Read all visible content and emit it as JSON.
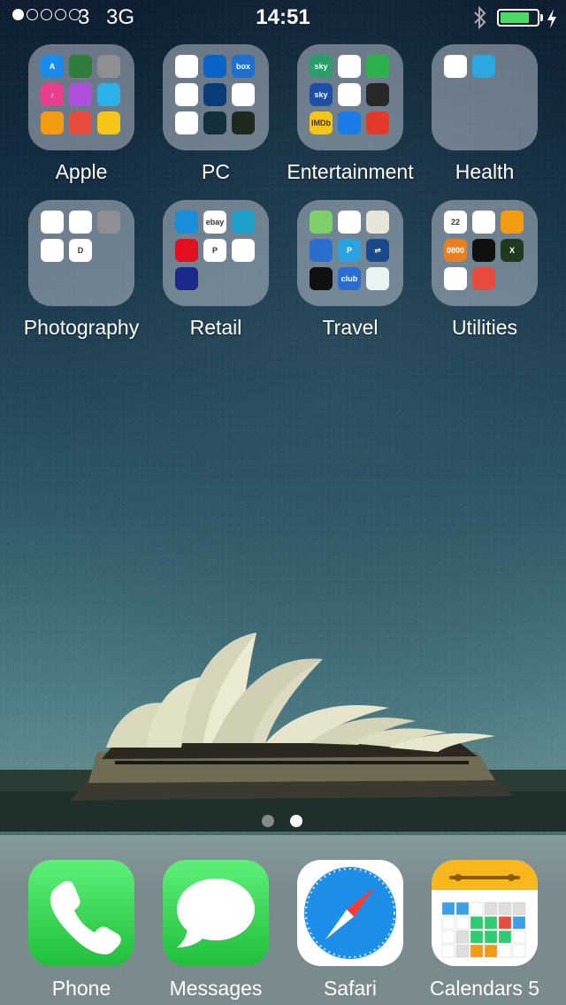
{
  "status_bar": {
    "carrier": "3",
    "network": "3G",
    "time": "14:51",
    "signal_bars_filled": 1,
    "signal_bars_total": 5,
    "battery_level_percent": 80,
    "battery_color": "#4cd964"
  },
  "folders": [
    {
      "label": "Apple",
      "apps": [
        {
          "icon": "app-store-icon",
          "color": "#1a8cf0",
          "text": "A"
        },
        {
          "icon": "find-my-iphone-icon",
          "color": "#2f7d3a",
          "text": ""
        },
        {
          "icon": "settings-icon",
          "color": "#8e8e93",
          "text": ""
        },
        {
          "icon": "music-icon",
          "color": "#e83e8c",
          "text": "♪"
        },
        {
          "icon": "game-center-icon",
          "color": "#b050e0",
          "text": ""
        },
        {
          "icon": "passbook-icon",
          "color": "#2ab1e8",
          "text": ""
        },
        {
          "icon": "ibooks-icon",
          "color": "#f39c12",
          "text": ""
        },
        {
          "icon": "reminders-stack-icon",
          "color": "#e74c3c",
          "text": ""
        },
        {
          "icon": "tips-icon",
          "color": "#f5c518",
          "text": ""
        }
      ]
    },
    {
      "label": "PC",
      "apps": [
        {
          "icon": "dropbox-icon",
          "color": "#ffffff",
          "text": ""
        },
        {
          "icon": "onedrive-icon",
          "color": "#0a64c8",
          "text": ""
        },
        {
          "icon": "box-icon",
          "color": "#1f6fd1",
          "text": "box"
        },
        {
          "icon": "google-drive-icon",
          "color": "#ffffff",
          "text": ""
        },
        {
          "icon": "hootsuite-icon",
          "color": "#0a3c78",
          "text": ""
        },
        {
          "icon": "teamviewer-icon",
          "color": "#ffffff",
          "text": ""
        },
        {
          "icon": "chrome-icon",
          "color": "#ffffff",
          "text": ""
        },
        {
          "icon": "speedtest-icon",
          "color": "#14303c",
          "text": ""
        },
        {
          "icon": "alarm-clock-icon",
          "color": "#1e2a1e",
          "text": ""
        }
      ]
    },
    {
      "label": "Entertainment",
      "apps": [
        {
          "icon": "sky-go-icon",
          "color": "#2a9d6a",
          "text": "sky"
        },
        {
          "icon": "slack-icon",
          "color": "#ffffff",
          "text": ""
        },
        {
          "icon": "ondemand-icon",
          "color": "#2bb24c",
          "text": ""
        },
        {
          "icon": "sky-icon",
          "color": "#1f4fa8",
          "text": "sky"
        },
        {
          "icon": "vlc-icon",
          "color": "#ffffff",
          "text": ""
        },
        {
          "icon": "plex-icon",
          "color": "#282828",
          "text": ""
        },
        {
          "icon": "imdb-icon",
          "color": "#f5c518",
          "text": "IMDb"
        },
        {
          "icon": "shazam-icon",
          "color": "#1a7ce8",
          "text": ""
        },
        {
          "icon": "todoist-icon",
          "color": "#e23b2a",
          "text": ""
        }
      ]
    },
    {
      "label": "Health",
      "apps": [
        {
          "icon": "health-icon",
          "color": "#ffffff",
          "text": ""
        },
        {
          "icon": "fitness-runner-icon",
          "color": "#2aa8e0",
          "text": ""
        }
      ]
    },
    {
      "label": "Photography",
      "apps": [
        {
          "icon": "photos-icon",
          "color": "#ffffff",
          "text": ""
        },
        {
          "icon": "snapseed-icon",
          "color": "#ffffff",
          "text": ""
        },
        {
          "icon": "camera-icon",
          "color": "#8e8e93",
          "text": ""
        },
        {
          "icon": "instagram-icon",
          "color": "#ffffff",
          "text": ""
        },
        {
          "icon": "directory-d-icon",
          "color": "#ffffff",
          "text": "D"
        }
      ]
    },
    {
      "label": "Retail",
      "apps": [
        {
          "icon": "argos-icon",
          "color": "#1a8ed8",
          "text": ""
        },
        {
          "icon": "ebay-icon",
          "color": "#ffffff",
          "text": "ebay"
        },
        {
          "icon": "coop-bank-icon",
          "color": "#1ea0c8",
          "text": ""
        },
        {
          "icon": "santander-icon",
          "color": "#e0101e",
          "text": ""
        },
        {
          "icon": "paypal-icon",
          "color": "#ffffff",
          "text": "P"
        },
        {
          "icon": "tesco-icon",
          "color": "#ffffff",
          "text": ""
        },
        {
          "icon": "lottery-icon",
          "color": "#1e2a8a",
          "text": ""
        }
      ]
    },
    {
      "label": "Travel",
      "apps": [
        {
          "icon": "maps-icon",
          "color": "#7fcf6a",
          "text": ""
        },
        {
          "icon": "google-maps-icon",
          "color": "#ffffff",
          "text": ""
        },
        {
          "icon": "bus-map-icon",
          "color": "#e9e4d8",
          "text": ""
        },
        {
          "icon": "radar-icon",
          "color": "#2a6fd0",
          "text": ""
        },
        {
          "icon": "parking-icon",
          "color": "#2aa2e0",
          "text": "P"
        },
        {
          "icon": "national-rail-icon",
          "color": "#1b4a8c",
          "text": "⇌"
        },
        {
          "icon": "traffic-alert-icon",
          "color": "#111111",
          "text": ""
        },
        {
          "icon": "club-icon",
          "color": "#2a6cd0",
          "text": "club"
        },
        {
          "icon": "wifi-finder-icon",
          "color": "#e8f4f4",
          "text": ""
        }
      ]
    },
    {
      "label": "Utilities",
      "apps": [
        {
          "icon": "calendar-icon",
          "color": "#ffffff",
          "text": "22"
        },
        {
          "icon": "reminders-icon",
          "color": "#ffffff",
          "text": ""
        },
        {
          "icon": "calculator-icon",
          "color": "#f39c12",
          "text": ""
        },
        {
          "icon": "0800-icon",
          "color": "#e67e22",
          "text": "0800"
        },
        {
          "icon": "remote-icon",
          "color": "#111111",
          "text": ""
        },
        {
          "icon": "xbox-icon",
          "color": "#1f3a1f",
          "text": "X"
        },
        {
          "icon": "barcode-scanner-icon",
          "color": "#ffffff",
          "text": ""
        },
        {
          "icon": "feather-icon",
          "color": "#e74c3c",
          "text": ""
        }
      ]
    }
  ],
  "page_indicator": {
    "pages": 2,
    "active": 2
  },
  "dock": [
    {
      "label": "Phone",
      "icon": "phone-icon",
      "color": "#2ecc40"
    },
    {
      "label": "Messages",
      "icon": "messages-icon",
      "color": "#2ecc40"
    },
    {
      "label": "Safari",
      "icon": "safari-icon",
      "color": "#ffffff"
    },
    {
      "label": "Calendars 5",
      "icon": "calendars-5-icon",
      "color": "#ffffff"
    }
  ]
}
